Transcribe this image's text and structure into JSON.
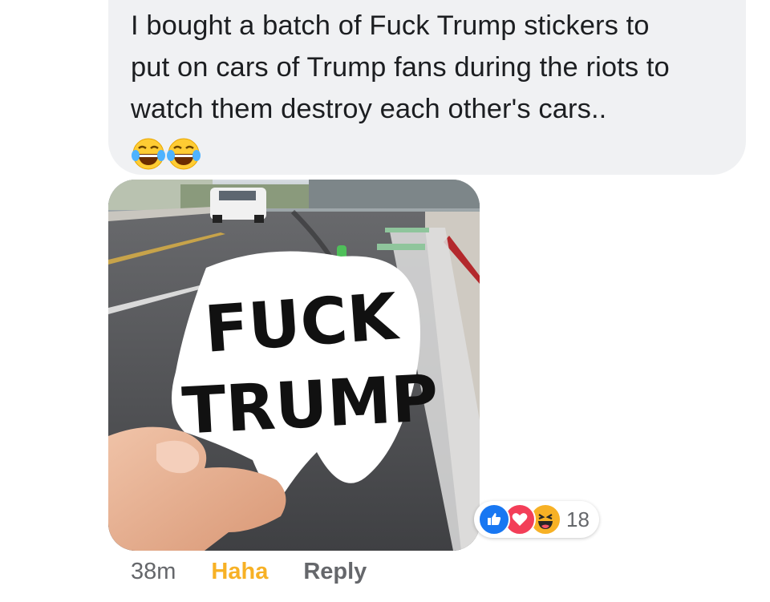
{
  "comment": {
    "text": "I bought a batch of Fuck Trump stickers to\nput on cars of Trump fans during the riots to\nwatch them destroy each other's cars..",
    "emojis": [
      "face-with-tears-of-joy-icon",
      "face-with-tears-of-joy-icon"
    ],
    "bubble_color": "#f0f1f3"
  },
  "photo": {
    "sticker_line1": "FUCK",
    "sticker_line2": "TRUMP"
  },
  "reactions": {
    "icons": [
      "like-icon",
      "love-icon",
      "haha-icon"
    ],
    "count": "18"
  },
  "actions": {
    "time": "38m",
    "reaction_label": "Haha",
    "reply_label": "Reply",
    "reaction_color": "#f7b125"
  }
}
